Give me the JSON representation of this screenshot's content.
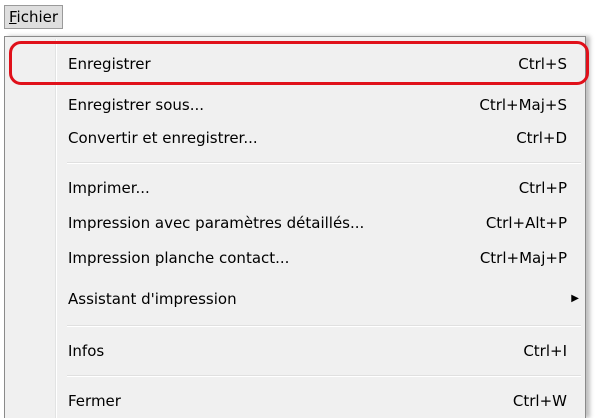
{
  "menubar": {
    "fichier_label_prefix": "F",
    "fichier_label_rest": "ichier"
  },
  "menu": {
    "items": [
      {
        "label": "Enregistrer",
        "shortcut": "Ctrl+S"
      },
      {
        "label": "Enregistrer sous...",
        "shortcut": "Ctrl+Maj+S"
      },
      {
        "label": "Convertir et enregistrer...",
        "shortcut": "Ctrl+D"
      },
      {
        "label": "Imprimer...",
        "shortcut": "Ctrl+P"
      },
      {
        "label": "Impression avec paramètres détaillés...",
        "shortcut": "Ctrl+Alt+P"
      },
      {
        "label": "Impression planche contact...",
        "shortcut": "Ctrl+Maj+P"
      },
      {
        "label": "Assistant d'impression",
        "shortcut": ""
      },
      {
        "label": "Infos",
        "shortcut": "Ctrl+I"
      },
      {
        "label": "Fermer",
        "shortcut": "Ctrl+W"
      }
    ],
    "submenu_arrow_icon": "chevron-right-icon",
    "highlight_color": "#e0101a"
  }
}
